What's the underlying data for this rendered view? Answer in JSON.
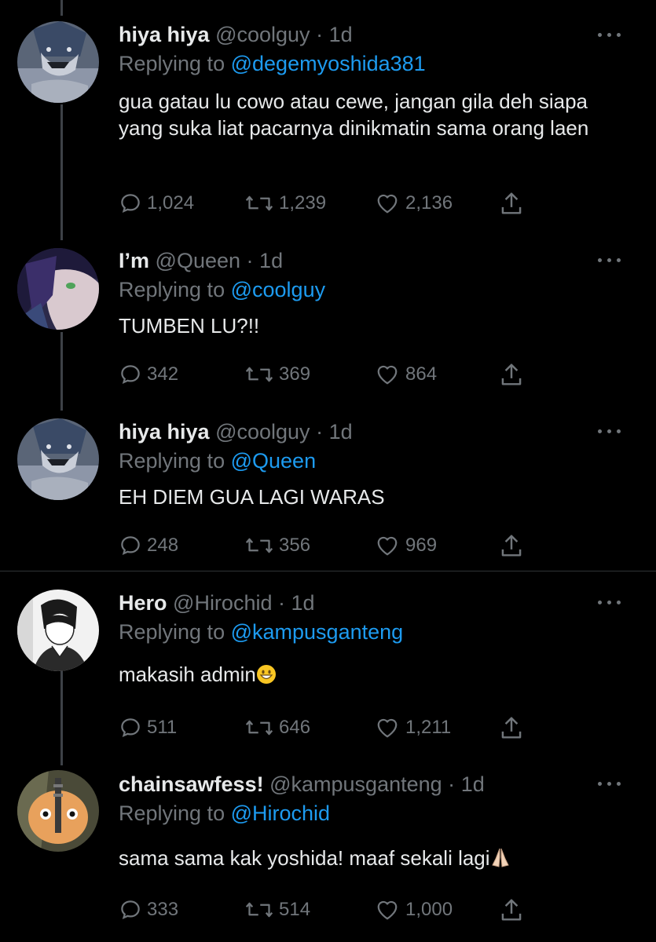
{
  "tweets": [
    {
      "name": "hiya hiya",
      "handle": "@coolguy",
      "dot": "·",
      "time": "1d",
      "replying_prefix": "Replying to",
      "replying_to": "@degemyoshida381",
      "text": "gua gatau lu cowo atau cewe, jangan gila deh siapa yang suka liat pacarnya dinikmatin sama orang laen",
      "replies": "1,024",
      "retweets": "1,239",
      "likes": "2,136",
      "avatar": "anime-shark-avatar"
    },
    {
      "name": "I’m",
      "handle": "@Queen",
      "dot": "·",
      "time": "1d",
      "replying_prefix": "Replying to",
      "replying_to": "@coolguy",
      "text": "TUMBEN LU?!!",
      "replies": "342",
      "retweets": "369",
      "likes": "864",
      "avatar": "anime-purple-hair-avatar"
    },
    {
      "name": "hiya hiya",
      "handle": "@coolguy",
      "dot": "·",
      "time": "1d",
      "replying_prefix": "Replying to",
      "replying_to": "@Queen",
      "text": "EH DIEM GUA LAGI WARAS",
      "replies": "248",
      "retweets": "356",
      "likes": "969",
      "avatar": "anime-shark-avatar"
    },
    {
      "name": "Hero",
      "handle": "@Hirochid",
      "dot": "·",
      "time": "1d",
      "replying_prefix": "Replying to",
      "replying_to": "@kampusganteng",
      "text": "makasih admin",
      "emoji": "grinning-face-emoji",
      "replies": "511",
      "retweets": "646",
      "likes": "1,211",
      "avatar": "manga-boy-avatar"
    },
    {
      "name": "chainsawfess!",
      "handle": "@kampusganteng",
      "dot": "·",
      "time": "1d",
      "replying_prefix": "Replying to",
      "replying_to": "@Hirochid",
      "text": "sama sama kak yoshida! maaf sekali lagi",
      "emoji": "folded-hands-emoji",
      "replies": "333",
      "retweets": "514",
      "likes": "1,000",
      "avatar": "pochita-avatar"
    }
  ],
  "colors": {
    "background": "#000000",
    "text": "#e7e9ea",
    "muted": "#71767b",
    "mention": "#1d9bf0",
    "divider": "#2f3336"
  }
}
